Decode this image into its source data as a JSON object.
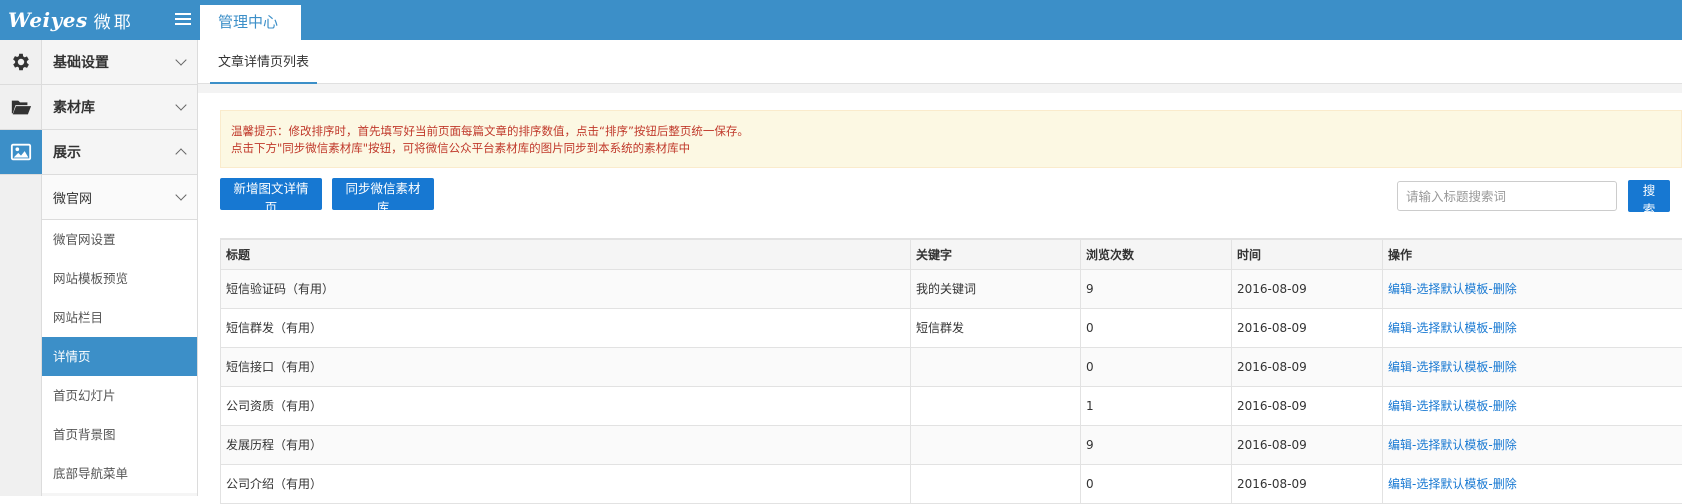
{
  "header": {
    "logo_en": "Weiyes",
    "logo_cn": "微耶",
    "tab": "管理中心"
  },
  "colors": {
    "primary": "#3c8fc8",
    "button": "#1778d2",
    "notice_bg": "#fcf8e3",
    "notice_text": "#c0392b"
  },
  "iconbar": [
    "gear-icon",
    "folder-icon",
    "image-icon"
  ],
  "sidebar": {
    "groups": [
      {
        "label": "基础设置",
        "state": "collapsed"
      },
      {
        "label": "素材库",
        "state": "collapsed"
      },
      {
        "label": "展示",
        "state": "expanded"
      }
    ],
    "subgroup": {
      "label": "微官网",
      "state": "collapsed"
    },
    "items": [
      {
        "label": "微官网设置"
      },
      {
        "label": "网站模板预览"
      },
      {
        "label": "网站栏目"
      },
      {
        "label": "详情页"
      },
      {
        "label": "首页幻灯片"
      },
      {
        "label": "首页背景图"
      },
      {
        "label": "底部导航菜单"
      }
    ]
  },
  "main": {
    "subtab": "文章详情页列表",
    "notice": {
      "line1": "温馨提示：修改排序时，首先填写好当前页面每篇文章的排序数值，点击“排序”按钮后整页统一保存。",
      "line2": "点击下方\"同步微信素材库\"按钮，可将微信公众平台素材库的图片同步到本系统的素材库中"
    },
    "buttons": {
      "add": "新增图文详情页",
      "sync": "同步微信素材库",
      "search": "搜索"
    },
    "search": {
      "placeholder": "请输入标题搜索词",
      "value": ""
    },
    "table": {
      "headers": [
        "标题",
        "关键字",
        "浏览次数",
        "时间",
        "操作"
      ],
      "actions": {
        "edit": "编辑",
        "select_template": "选择默认模板",
        "delete": "删除",
        "sep": "-"
      },
      "rows": [
        {
          "title": "短信验证码（有用）",
          "keyword": "我的关键词",
          "views": "9",
          "date": "2016-08-09"
        },
        {
          "title": "短信群发（有用）",
          "keyword": "短信群发",
          "views": "0",
          "date": "2016-08-09"
        },
        {
          "title": "短信接口（有用）",
          "keyword": "",
          "views": "0",
          "date": "2016-08-09"
        },
        {
          "title": "公司资质（有用）",
          "keyword": "",
          "views": "1",
          "date": "2016-08-09"
        },
        {
          "title": "发展历程（有用）",
          "keyword": "",
          "views": "9",
          "date": "2016-08-09"
        },
        {
          "title": "公司介绍（有用）",
          "keyword": "",
          "views": "0",
          "date": "2016-08-09"
        }
      ]
    }
  }
}
